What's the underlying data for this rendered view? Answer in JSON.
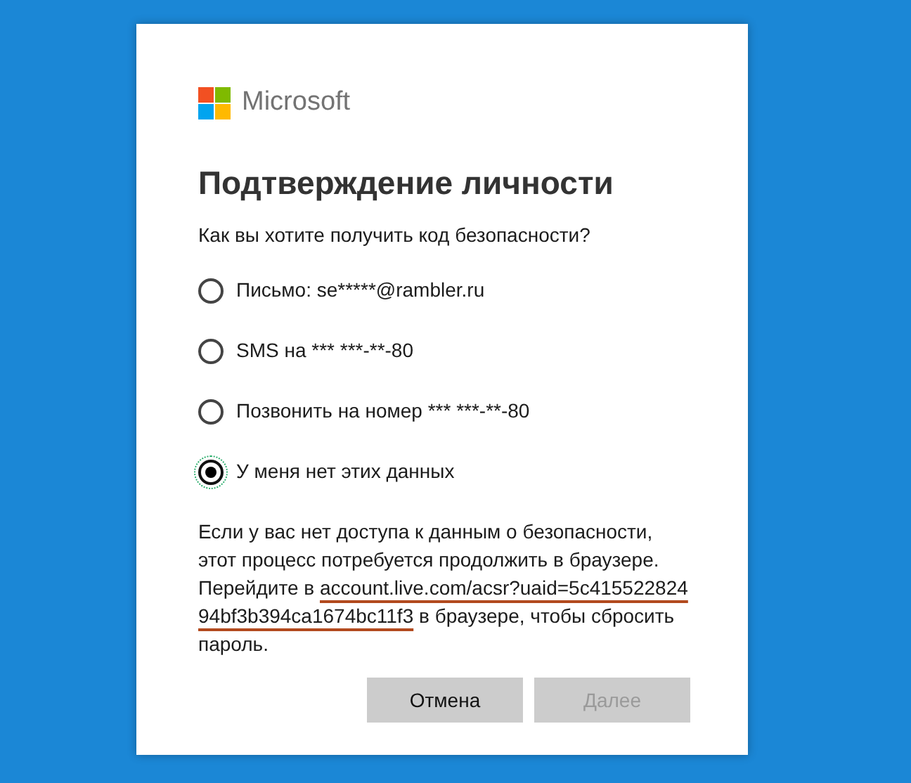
{
  "logo": {
    "text": "Microsoft"
  },
  "title": "Подтверждение личности",
  "question": "Как вы хотите получить код безопасности?",
  "options": [
    {
      "label": "Письмо: se*****@rambler.ru",
      "selected": false
    },
    {
      "label": "SMS на *** ***-**-80",
      "selected": false
    },
    {
      "label": "Позвонить на номер *** ***-**-80",
      "selected": false
    },
    {
      "label": "У меня нет этих данных",
      "selected": true
    }
  ],
  "info": {
    "before": "Если у вас нет доступа к данным о безопасности, этот процесс потребуется продолжить в браузере. Перейдите в ",
    "url": "account.live.com/acsr?uaid=5c41552282494bf3b394ca1674bc11f3",
    "after": " в браузере, чтобы сбросить пароль."
  },
  "buttons": [
    {
      "label": "Отмена",
      "disabled": false
    },
    {
      "label": "Далее",
      "disabled": true
    }
  ]
}
